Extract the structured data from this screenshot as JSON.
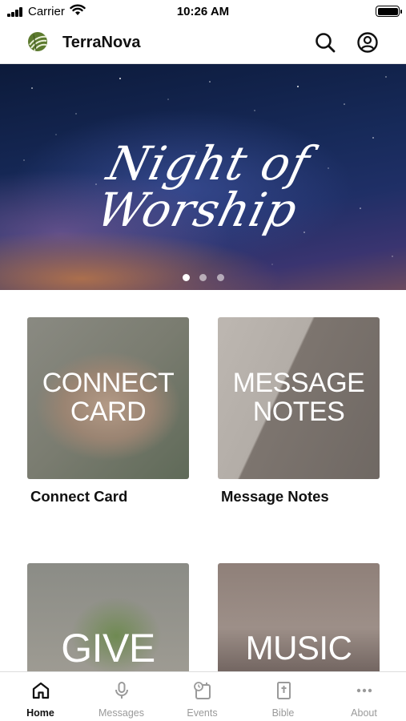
{
  "status_bar": {
    "carrier": "Carrier",
    "time": "10:26 AM"
  },
  "header": {
    "title": "TerraNova",
    "logo_icon": "leaf-logo-icon",
    "search_icon": "search-icon",
    "profile_icon": "profile-icon"
  },
  "hero": {
    "title": "Night of Worship",
    "slides_total": 3,
    "active_slide": 1
  },
  "cards": [
    {
      "overlay": "CONNECT CARD",
      "label": "Connect Card"
    },
    {
      "overlay": "MESSAGE NOTES",
      "label": "Message Notes"
    },
    {
      "overlay": "GIVE",
      "label": ""
    },
    {
      "overlay": "MUSIC",
      "label": ""
    }
  ],
  "bottom_nav": [
    {
      "label": "Home",
      "icon": "home-icon",
      "active": true
    },
    {
      "label": "Messages",
      "icon": "microphone-icon",
      "active": false
    },
    {
      "label": "Events",
      "icon": "calendar-clock-icon",
      "active": false
    },
    {
      "label": "Bible",
      "icon": "bible-icon",
      "active": false
    },
    {
      "label": "About",
      "icon": "more-dots-icon",
      "active": false
    }
  ],
  "colors": {
    "active_nav": "#111111",
    "inactive_nav": "#9a9a9a",
    "hero_sky": "#172a5a"
  }
}
